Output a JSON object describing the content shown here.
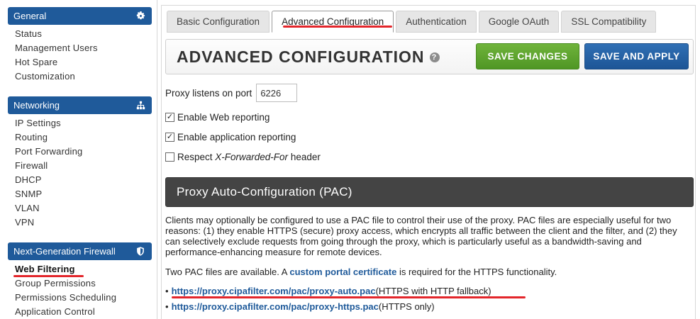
{
  "sidebar": {
    "general": {
      "title": "General",
      "icon": "gear-icon",
      "items": [
        "Status",
        "Management Users",
        "Hot Spare",
        "Customization"
      ]
    },
    "networking": {
      "title": "Networking",
      "icon": "network-icon",
      "items": [
        "IP Settings",
        "Routing",
        "Port Forwarding",
        "Firewall",
        "DHCP",
        "SNMP",
        "VLAN",
        "VPN"
      ]
    },
    "ngfw": {
      "title": "Next-Generation Firewall",
      "icon": "shield-icon",
      "items": [
        "Web Filtering",
        "Group Permissions",
        "Permissions Scheduling",
        "Application Control"
      ],
      "active": "Web Filtering"
    }
  },
  "tabs": [
    "Basic Configuration",
    "Advanced Configuration",
    "Authentication",
    "Google OAuth",
    "SSL Compatibility"
  ],
  "active_tab": "Advanced Configuration",
  "header": {
    "title": "ADVANCED CONFIGURATION",
    "help": "?",
    "save_label": "SAVE CHANGES",
    "apply_label": "SAVE AND APPLY"
  },
  "form": {
    "port_label": "Proxy listens on port",
    "port_value": "6226",
    "web_reporting_label": "Enable Web reporting",
    "web_reporting_checked": true,
    "app_reporting_label": "Enable application reporting",
    "app_reporting_checked": true,
    "respect_prefix": "Respect ",
    "respect_header_name": "X-Forwarded-For",
    "respect_suffix": " header",
    "respect_checked": false
  },
  "pac": {
    "section_title": "Proxy Auto-Configuration (PAC)",
    "description": "Clients may optionally be configured to use a PAC file to control their use of the proxy. PAC files are especially useful for two reasons: (1) they enable HTTPS (secure) proxy access, which encrypts all traffic between the client and the filter, and (2) they can selectively exclude requests from going through the proxy, which is particularly useful as a bandwidth-saving and performance-enhancing measure for remote devices.",
    "available_prefix": "Two PAC files are available. A ",
    "available_link": "custom portal certificate",
    "available_suffix": " is required for the HTTPS functionality.",
    "files": [
      {
        "url": "https://proxy.cipafilter.com/pac/proxy-auto.pac",
        "note": " (HTTPS with HTTP fallback)"
      },
      {
        "url": "https://proxy.cipafilter.com/pac/proxy-https.pac",
        "note": " (HTTPS only)"
      }
    ]
  },
  "colors": {
    "sidebar_head": "#1f5a9a",
    "save_green": "#5aa32d",
    "apply_blue": "#235d9f",
    "annotation_red": "#e3262b",
    "section_dark": "#444444"
  }
}
